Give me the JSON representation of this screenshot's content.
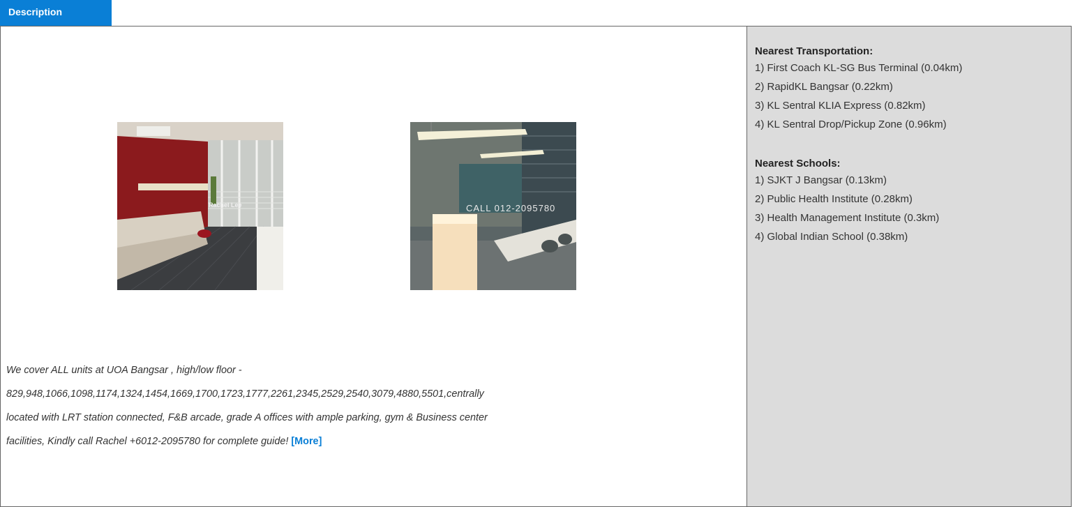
{
  "tab": {
    "label": "Description"
  },
  "photos": [
    {
      "watermark": "Rachel Lee",
      "alt": "office-lounge-photo"
    },
    {
      "watermark": "CALL 012-2095780",
      "alt": "office-workspace-photo"
    }
  ],
  "description": {
    "lines": [
      "We cover ALL units at UOA Bangsar , high/low floor -",
      "829,948,1066,1098,1174,1324,1454,1669,1700,1723,1777,2261,2345,2529,2540,3079,4880,5501,centrally",
      "located with LRT station connected, F&B arcade, grade A offices with ample parking, gym & Business center",
      "facilities, Kindly call Rachel +6012-2095780 for complete guide!"
    ],
    "more_label": "[More]"
  },
  "transportation": {
    "heading": "Nearest Transportation:",
    "items": [
      "1) First Coach KL-SG Bus Terminal (0.04km)",
      "2) RapidKL Bangsar (0.22km)",
      "3) KL Sentral KLIA Express (0.82km)",
      "4) KL Sentral Drop/Pickup Zone (0.96km)"
    ]
  },
  "schools": {
    "heading": "Nearest Schools:",
    "items": [
      "1) SJKT J Bangsar (0.13km)",
      "2) Public Health Institute (0.28km)",
      "3) Health Management Institute (0.3km)",
      "4) Global Indian School (0.38km)"
    ]
  },
  "colors": {
    "accent": "#0a7fd6",
    "sidebar_bg": "#dcdcdc",
    "border": "#666666"
  }
}
